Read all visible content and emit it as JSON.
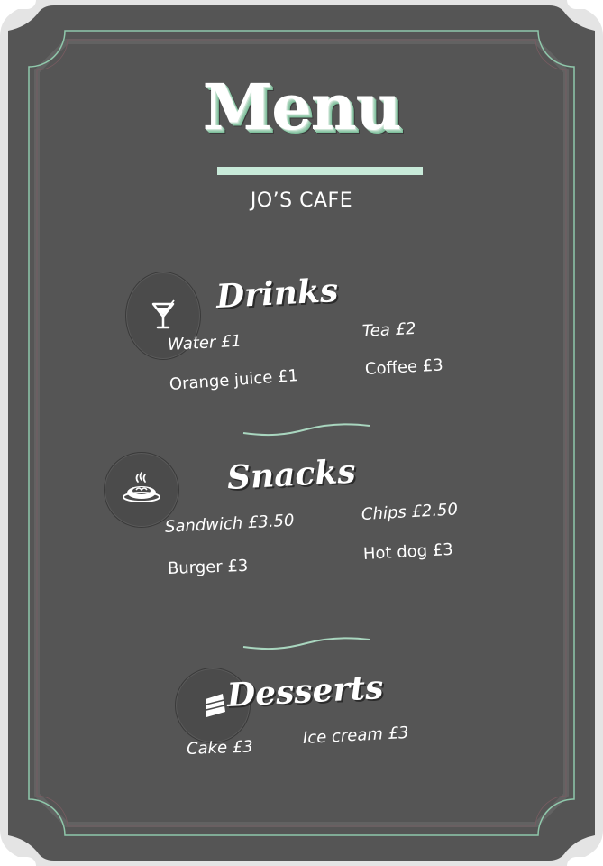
{
  "menu": {
    "title": "Menu",
    "cafe_name": "JO’S CAFE"
  },
  "sections": [
    {
      "title": "Drinks",
      "icon": "cocktail-glass-icon",
      "items": [
        "Water £1",
        "Orange juice £1",
        "Tea £2",
        "Coffee £3"
      ]
    },
    {
      "title": "Snacks",
      "icon": "hot-dish-icon",
      "items": [
        "Sandwich £3.50",
        "Burger £3",
        "Chips £2.50",
        "Hot dog £3"
      ]
    },
    {
      "title": "Desserts",
      "icon": "cake-slice-icon",
      "items": [
        "Cake £3",
        "Ice cream £3"
      ]
    }
  ],
  "colors": {
    "board": "#555555",
    "outer_frame": "#e4e4e4",
    "accent_mint": "#c8ead9",
    "accent_line": "#9bd2b6"
  }
}
